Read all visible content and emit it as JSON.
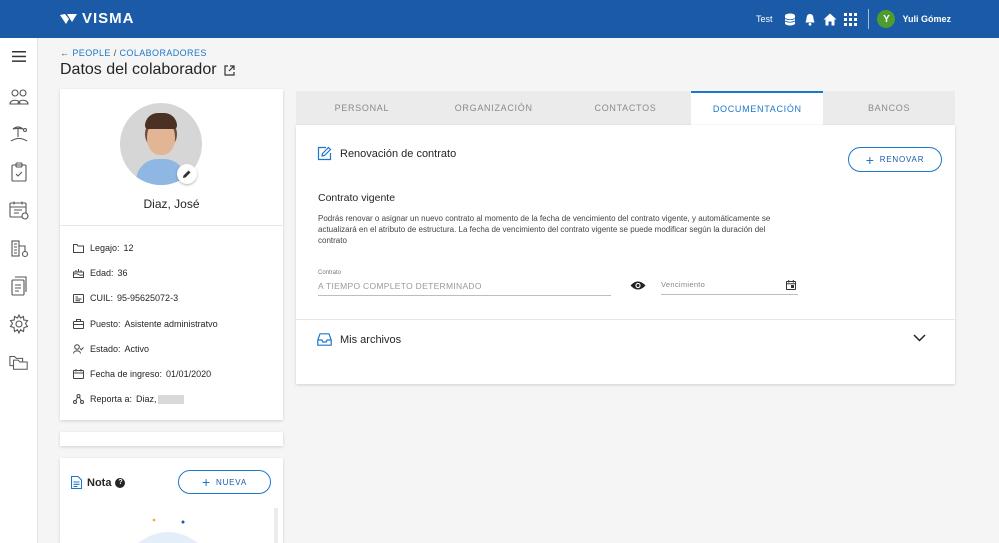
{
  "header": {
    "brand": "VISMA",
    "environment": "Test",
    "user_initial": "Y",
    "user_name": "Yuli Gómez",
    "icons": [
      "database-icon",
      "bell-icon",
      "home-icon",
      "apps-grid-icon"
    ]
  },
  "sidebar": {
    "items": [
      "menu-icon",
      "people-icon",
      "vacation-icon",
      "clipboard-icon",
      "calendar-icon",
      "organization-icon",
      "documents-icon",
      "settings-icon",
      "folders-icon"
    ]
  },
  "breadcrumb": {
    "part1": "PEOPLE",
    "separator": " / ",
    "part2": "COLABORADORES"
  },
  "page": {
    "title": "Datos del colaborador"
  },
  "profile": {
    "name": "Diaz, José",
    "fields": [
      {
        "label": "Legajo:",
        "value": "12"
      },
      {
        "label": "Edad:",
        "value": "36"
      },
      {
        "label": "CUIL:",
        "value": "95-95625072-3"
      },
      {
        "label": "Puesto:",
        "value": "Asistente administratvo"
      },
      {
        "label": "Estado:",
        "value": "Activo"
      },
      {
        "label": "Fecha de ingreso:",
        "value": "01/01/2020"
      },
      {
        "label": "Reporta a:",
        "value": "Diaz,"
      }
    ]
  },
  "note": {
    "title": "Nota",
    "help": "?",
    "new_label": "NUEVA"
  },
  "tabs": [
    {
      "label": "PERSONAL",
      "active": false
    },
    {
      "label": "ORGANIZACIÓN",
      "active": false
    },
    {
      "label": "CONTACTOS",
      "active": false
    },
    {
      "label": "DOCUMENTACIÓN",
      "active": true
    },
    {
      "label": "BANCOS",
      "active": false
    }
  ],
  "contract": {
    "title": "Renovación de contrato",
    "renew_label": "RENOVAR",
    "subtitle": "Contrato vigente",
    "description": "Podrás renovar o asignar un nuevo contrato al momento de la fecha de vencimiento del contrato vigente, y automáticamente se actualizará en el atributo de estructura. La fecha de vencimiento del contrato vigente se puede modificar según la duración del contrato",
    "contract_label": "Contrato",
    "contract_value": "A TIEMPO COMPLETO DETERMINADO",
    "expiry_placeholder": "Vencimiento"
  },
  "files": {
    "title": "Mis archivos"
  },
  "colors": {
    "brand": "#1b5aa7",
    "accent": "#1b78c9",
    "active_badge": "#4e9c2d"
  }
}
